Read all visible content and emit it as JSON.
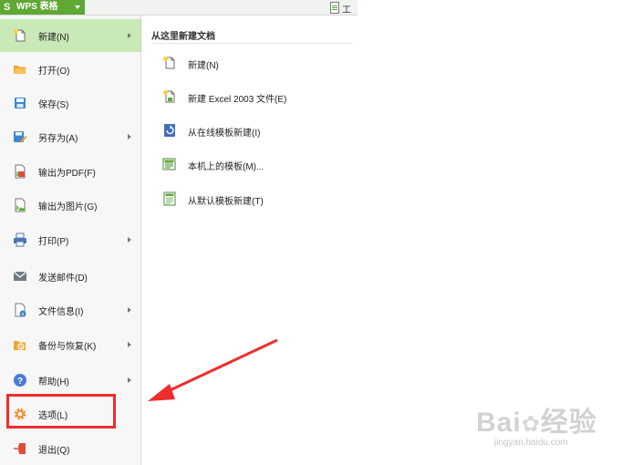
{
  "app": {
    "title": "WPS 表格",
    "logo_letter": "S",
    "brand_color": "#5fa834"
  },
  "topbar": {
    "right_text": "工作"
  },
  "menu": {
    "items": [
      {
        "label": "新建(N)",
        "icon": "new-document-icon",
        "has_submenu": true,
        "active": true
      },
      {
        "label": "打开(O)",
        "icon": "open-folder-icon",
        "has_submenu": false
      },
      {
        "label": "保存(S)",
        "icon": "save-icon",
        "has_submenu": false
      },
      {
        "label": "另存为(A)",
        "icon": "save-as-icon",
        "has_submenu": true
      },
      {
        "label": "输出为PDF(F)",
        "icon": "export-pdf-icon",
        "has_submenu": false
      },
      {
        "label": "输出为图片(G)",
        "icon": "export-image-icon",
        "has_submenu": false
      },
      {
        "label": "打印(P)",
        "icon": "printer-icon",
        "has_submenu": true
      },
      {
        "label": "发送邮件(D)",
        "icon": "mail-icon",
        "has_submenu": false
      },
      {
        "label": "文件信息(I)",
        "icon": "file-info-icon",
        "has_submenu": true
      },
      {
        "label": "备份与恢复(K)",
        "icon": "backup-icon",
        "has_submenu": true
      },
      {
        "label": "帮助(H)",
        "icon": "help-icon",
        "has_submenu": true
      },
      {
        "label": "选项(L)",
        "icon": "gear-icon",
        "has_submenu": false
      },
      {
        "label": "退出(Q)",
        "icon": "exit-icon",
        "has_submenu": false
      }
    ]
  },
  "submenu": {
    "heading": "从这里新建文档",
    "items": [
      {
        "label": "新建(N)",
        "icon": "new-document-icon"
      },
      {
        "label": "新建 Excel 2003 文件(E)",
        "icon": "new-excel-icon"
      },
      {
        "label": "从在线模板新建(I)",
        "icon": "online-template-icon"
      },
      {
        "label": "本机上的模板(M)...",
        "icon": "local-template-icon"
      },
      {
        "label": "从默认模板新建(T)",
        "icon": "default-template-icon"
      }
    ]
  },
  "annotation": {
    "highlight_color": "#ee2d2d"
  },
  "watermark": {
    "text_a": "Bai",
    "text_b": "经验",
    "subtext": "jingyan.baidu.com"
  }
}
